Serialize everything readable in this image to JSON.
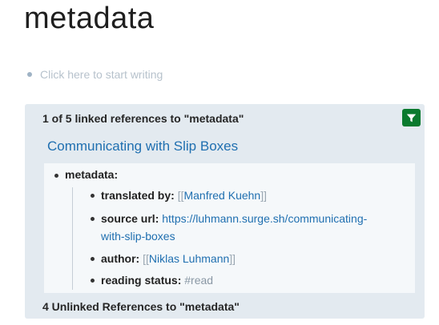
{
  "page": {
    "title": "metadata"
  },
  "empty_block": {
    "placeholder": "Click here to start writing"
  },
  "linked_refs": {
    "header": "1 of 5 linked references to \"metadata\"",
    "filter_icon": "filter-icon",
    "filter_color": "#0a7a2e",
    "page_link": "Communicating with Slip Boxes",
    "block": {
      "parent": "metadata:",
      "children": [
        {
          "key": "translated by:",
          "open": "[[",
          "value": "Manfred Kuehn",
          "close": "]]"
        },
        {
          "key": "source url:",
          "value_line1": "https://luhmann.surge.sh/communicating-",
          "value_line2": "with-slip-boxes"
        },
        {
          "key": "author:",
          "open": "[[",
          "value": "Niklas Luhmann",
          "close": "]]"
        },
        {
          "key": "reading status:",
          "value": "#read"
        }
      ]
    }
  },
  "unlinked_refs": {
    "header": "4 Unlinked References to \"metadata\""
  }
}
